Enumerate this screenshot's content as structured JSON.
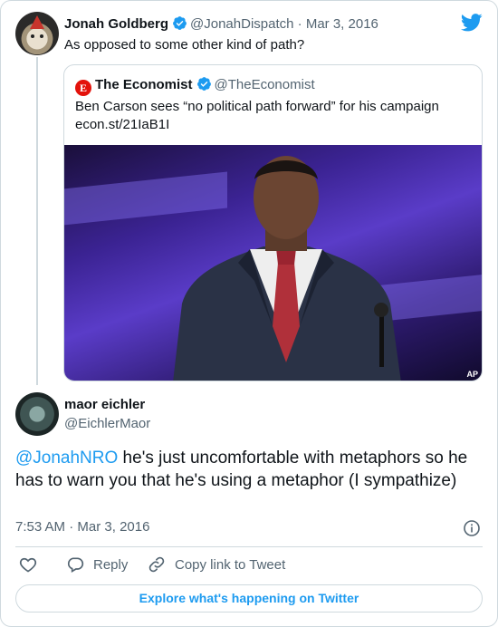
{
  "parent_tweet": {
    "author_name": "Jonah Goldberg",
    "handle": "@JonahDispatch",
    "separator": "·",
    "date": "Mar 3, 2016",
    "text": "As opposed to some other kind of path?"
  },
  "quoted_tweet": {
    "logo_letter": "E",
    "author_name": "The Economist",
    "handle": "@TheEconomist",
    "text_line1": "Ben Carson sees “no political path forward” for his campaign",
    "text_line2": "econ.st/21IaB1I",
    "image_credit": "AP"
  },
  "reply_tweet": {
    "author_name": "maor eichler",
    "handle": "@EichlerMaor",
    "mention": "@JonahNRO",
    "text_rest": " he's just uncomfortable with metaphors so he has to warn you that he's using a metaphor (I sympathize)",
    "time": "7:53 AM",
    "separator": "·",
    "date": "Mar 3, 2016"
  },
  "actions": {
    "reply_label": "Reply",
    "copy_link_label": "Copy link to Tweet"
  },
  "footer": {
    "explore_label": "Explore what's happening on Twitter"
  },
  "colors": {
    "accent": "#1d9bf0",
    "secondary_text": "#536471",
    "border": "#cfd9de",
    "economist_red": "#e3120b"
  },
  "icons": [
    "verified-badge-icon",
    "twitter-bird-icon",
    "info-icon",
    "heart-icon",
    "reply-bubble-icon",
    "link-icon"
  ]
}
